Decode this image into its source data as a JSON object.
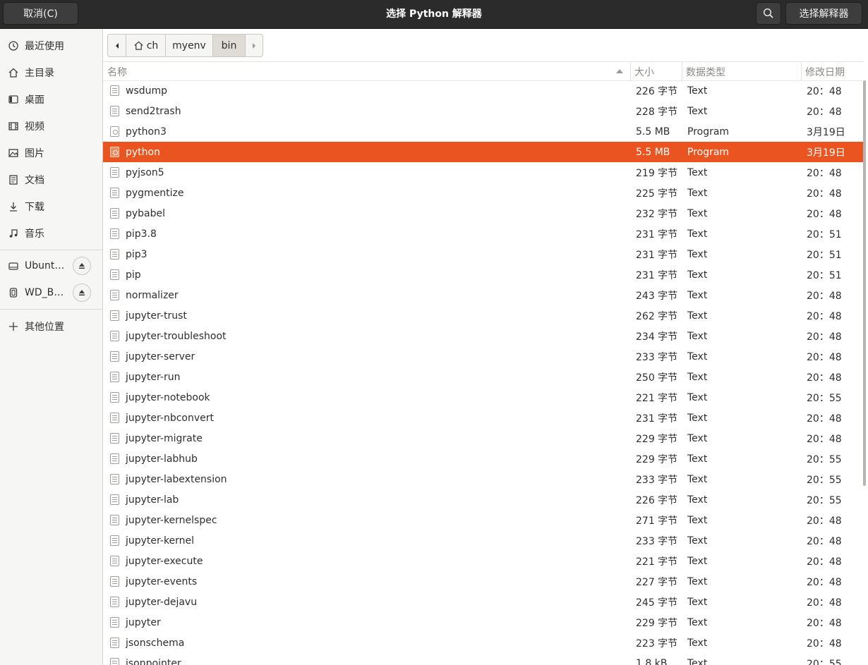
{
  "header": {
    "title": "选择 Python 解释器",
    "cancel_label": "取消(C)",
    "select_label": "选择解释器",
    "search_icon": "search-icon"
  },
  "sidebar": {
    "items": [
      {
        "label": "最近使用",
        "icon": "recent-icon"
      },
      {
        "label": "主目录",
        "icon": "home-icon"
      },
      {
        "label": "桌面",
        "icon": "desktop-icon"
      },
      {
        "label": "视频",
        "icon": "video-icon"
      },
      {
        "label": "图片",
        "icon": "picture-icon"
      },
      {
        "label": "文档",
        "icon": "document-icon"
      },
      {
        "label": "下载",
        "icon": "download-icon"
      },
      {
        "label": "音乐",
        "icon": "music-icon"
      }
    ],
    "devices": [
      {
        "label": "Ubunt…",
        "icon": "drive-icon"
      },
      {
        "label": "WD_B…",
        "icon": "usb-drive-icon"
      }
    ],
    "other_label": "其他位置"
  },
  "pathbar": {
    "segments": [
      "ch",
      "myenv",
      "bin"
    ],
    "active": "bin"
  },
  "columns": {
    "name": "名称",
    "size": "大小",
    "type": "数据类型",
    "modified": "修改日期"
  },
  "files": [
    {
      "name": "wsdump",
      "size": "226 字节",
      "type": "Text",
      "modified": "20：48"
    },
    {
      "name": "send2trash",
      "size": "228 字节",
      "type": "Text",
      "modified": "20：48"
    },
    {
      "name": "python3",
      "size": "5.5 MB",
      "type": "Program",
      "modified": "3月19日"
    },
    {
      "name": "python",
      "size": "5.5 MB",
      "type": "Program",
      "modified": "3月19日",
      "selected": true
    },
    {
      "name": "pyjson5",
      "size": "219 字节",
      "type": "Text",
      "modified": "20：48"
    },
    {
      "name": "pygmentize",
      "size": "225 字节",
      "type": "Text",
      "modified": "20：48"
    },
    {
      "name": "pybabel",
      "size": "232 字节",
      "type": "Text",
      "modified": "20：48"
    },
    {
      "name": "pip3.8",
      "size": "231 字节",
      "type": "Text",
      "modified": "20：51"
    },
    {
      "name": "pip3",
      "size": "231 字节",
      "type": "Text",
      "modified": "20：51"
    },
    {
      "name": "pip",
      "size": "231 字节",
      "type": "Text",
      "modified": "20：51"
    },
    {
      "name": "normalizer",
      "size": "243 字节",
      "type": "Text",
      "modified": "20：48"
    },
    {
      "name": "jupyter-trust",
      "size": "262 字节",
      "type": "Text",
      "modified": "20：48"
    },
    {
      "name": "jupyter-troubleshoot",
      "size": "234 字节",
      "type": "Text",
      "modified": "20：48"
    },
    {
      "name": "jupyter-server",
      "size": "233 字节",
      "type": "Text",
      "modified": "20：48"
    },
    {
      "name": "jupyter-run",
      "size": "250 字节",
      "type": "Text",
      "modified": "20：48"
    },
    {
      "name": "jupyter-notebook",
      "size": "221 字节",
      "type": "Text",
      "modified": "20：55"
    },
    {
      "name": "jupyter-nbconvert",
      "size": "231 字节",
      "type": "Text",
      "modified": "20：48"
    },
    {
      "name": "jupyter-migrate",
      "size": "229 字节",
      "type": "Text",
      "modified": "20：48"
    },
    {
      "name": "jupyter-labhub",
      "size": "229 字节",
      "type": "Text",
      "modified": "20：55"
    },
    {
      "name": "jupyter-labextension",
      "size": "233 字节",
      "type": "Text",
      "modified": "20：55"
    },
    {
      "name": "jupyter-lab",
      "size": "226 字节",
      "type": "Text",
      "modified": "20：55"
    },
    {
      "name": "jupyter-kernelspec",
      "size": "271 字节",
      "type": "Text",
      "modified": "20：48"
    },
    {
      "name": "jupyter-kernel",
      "size": "233 字节",
      "type": "Text",
      "modified": "20：48"
    },
    {
      "name": "jupyter-execute",
      "size": "221 字节",
      "type": "Text",
      "modified": "20：48"
    },
    {
      "name": "jupyter-events",
      "size": "227 字节",
      "type": "Text",
      "modified": "20：48"
    },
    {
      "name": "jupyter-dejavu",
      "size": "245 字节",
      "type": "Text",
      "modified": "20：48"
    },
    {
      "name": "jupyter",
      "size": "229 字节",
      "type": "Text",
      "modified": "20：48"
    },
    {
      "name": "jsonschema",
      "size": "223 字节",
      "type": "Text",
      "modified": "20：48"
    },
    {
      "name": "jsonpointer",
      "size": "1.8 kB",
      "type": "Text",
      "modified": "20：55"
    }
  ],
  "colors": {
    "header_bg": "#2b2b2b",
    "selection": "#e95420",
    "sidebar_bg": "#f6f6f5"
  }
}
